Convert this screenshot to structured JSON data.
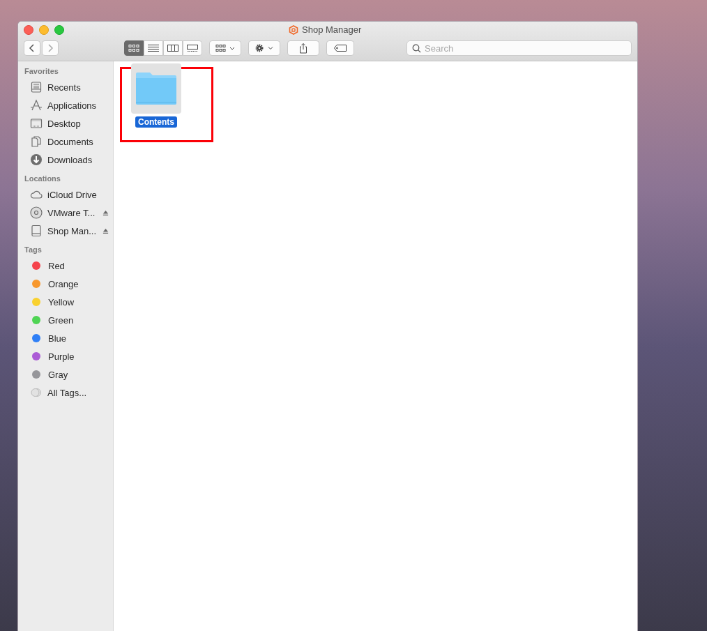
{
  "window": {
    "title": "Shop Manager"
  },
  "toolbar": {
    "view_modes": [
      {
        "selected": true
      },
      {
        "selected": false
      },
      {
        "selected": false
      },
      {
        "selected": false
      }
    ],
    "search": {
      "placeholder": "Search"
    }
  },
  "sidebar": {
    "sections": [
      {
        "title": "Favorites",
        "items": [
          {
            "label": "Recents"
          },
          {
            "label": "Applications"
          },
          {
            "label": "Desktop"
          },
          {
            "label": "Documents"
          },
          {
            "label": "Downloads"
          }
        ]
      },
      {
        "title": "Locations",
        "items": [
          {
            "label": "iCloud Drive",
            "ejectable": false
          },
          {
            "label": "VMware T...",
            "ejectable": true
          },
          {
            "label": "Shop Man...",
            "ejectable": true
          }
        ]
      },
      {
        "title": "Tags",
        "items": [
          {
            "label": "Red",
            "color": "#f5434c"
          },
          {
            "label": "Orange",
            "color": "#f7972d"
          },
          {
            "label": "Yellow",
            "color": "#f9d12f"
          },
          {
            "label": "Green",
            "color": "#4fd454"
          },
          {
            "label": "Blue",
            "color": "#2f7ff6"
          },
          {
            "label": "Purple",
            "color": "#ab5bd6"
          },
          {
            "label": "Gray",
            "color": "#96969a"
          },
          {
            "label": "All Tags...",
            "kind": "all"
          }
        ]
      }
    ]
  },
  "files": [
    {
      "name": "Contents",
      "selected": true,
      "highlighted": true
    }
  ]
}
